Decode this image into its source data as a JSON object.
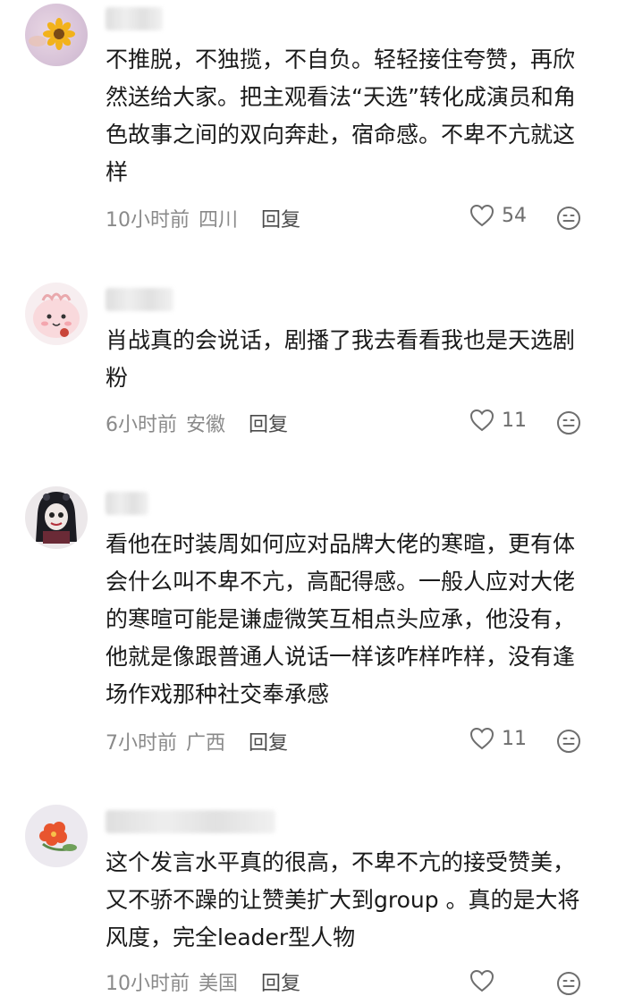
{
  "comments": [
    {
      "text": "不推脱，不独揽，不自负。轻轻接住夸赞，再欣然送给大家。把主观看法“天选”转化成演员和角色故事之间的双向奔赴，宿命感。不卑不亢就这样",
      "time": "10小时前",
      "location": "四川",
      "reply": "回复",
      "likes": "54"
    },
    {
      "text": "肖战真的会说话，剧播了我去看看我也是天选剧粉",
      "time": "6小时前",
      "location": "安徽",
      "reply": "回复",
      "likes": "11"
    },
    {
      "text": "看他在时装周如何应对品牌大佬的寒暄，更有体会什么叫不卑不亢，高配得感。一般人应对大佬的寒暄可能是谦虚微笑互相点头应承，他没有，他就是像跟普通人说话一样该咋样咋样，没有逢场作戏那种社交奉承感",
      "time": "7小时前",
      "location": "广西",
      "reply": "回复",
      "likes": "11"
    },
    {
      "text": "这个发言水平真的很高，不卑不亢的接受赞美，又不骄不躁的让赞美扩大到group 。真的是大将风度，完全leader型人物",
      "time": "10小时前",
      "location": "美国",
      "reply": "回复",
      "likes": ""
    }
  ],
  "icons": {
    "like": "heart-outline-icon",
    "emoji": "smiley-icon"
  },
  "colors": {
    "text": "#1a1a1a",
    "meta": "#8a8a8a",
    "reply": "#4b4b4b"
  }
}
